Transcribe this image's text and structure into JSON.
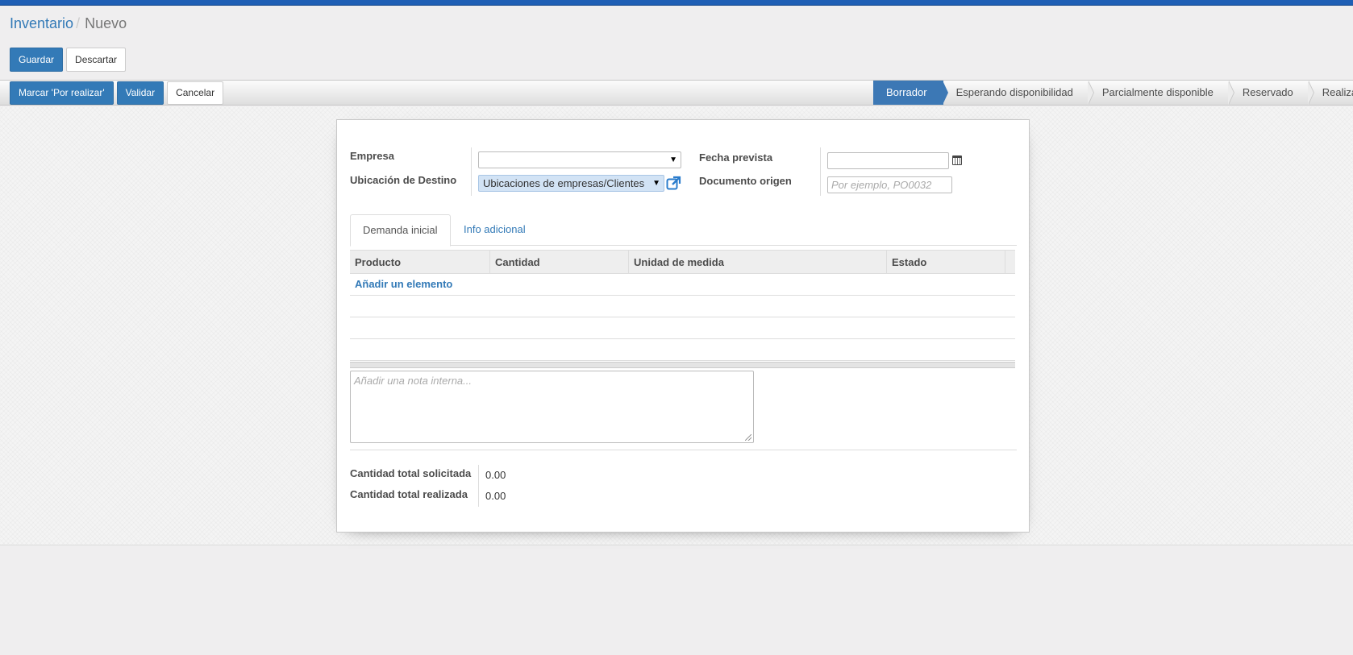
{
  "breadcrumb": {
    "parent": "Inventario",
    "separator": "/",
    "current": "Nuevo"
  },
  "actions": {
    "save": "Guardar",
    "discard": "Descartar"
  },
  "statusbar": {
    "buttons": {
      "mark_todo": "Marcar 'Por realizar'",
      "validate": "Validar",
      "cancel": "Cancelar"
    },
    "stages": [
      "Borrador",
      "Esperando disponibilidad",
      "Parcialmente disponible",
      "Reservado",
      "Realizado"
    ],
    "active_stage": "Borrador"
  },
  "form": {
    "empresa": {
      "label": "Empresa",
      "value": ""
    },
    "ubicacion": {
      "label": "Ubicación de Destino",
      "value": "Ubicaciones de empresas/Clientes"
    },
    "fecha": {
      "label": "Fecha prevista",
      "value": ""
    },
    "documento": {
      "label": "Documento origen",
      "placeholder": "Por ejemplo, PO0032"
    }
  },
  "tabs": [
    "Demanda inicial",
    "Info adicional"
  ],
  "table": {
    "columns": [
      "Producto",
      "Cantidad",
      "Unidad de medida",
      "Estado"
    ],
    "add_item": "Añadir un elemento"
  },
  "note": {
    "placeholder": "Añadir una nota interna..."
  },
  "totals": {
    "requested": {
      "label": "Cantidad total solicitada",
      "value": "0.00"
    },
    "done": {
      "label": "Cantidad total realizada",
      "value": "0.00"
    }
  },
  "colors": {
    "primary": "#337ab7",
    "topbar": "#1f5fb5",
    "active_stage": "#3c78b5"
  }
}
